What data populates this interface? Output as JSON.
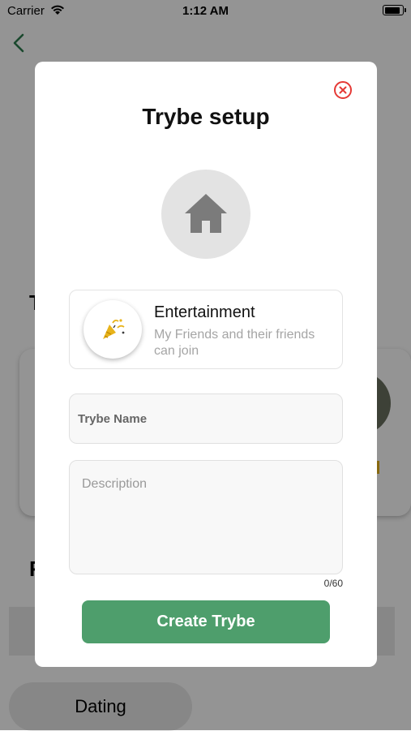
{
  "status_bar": {
    "carrier": "Carrier",
    "time": "1:12 AM"
  },
  "background": {
    "section_letters": [
      "T",
      "F"
    ],
    "pills": [
      "Dating"
    ]
  },
  "modal": {
    "title": "Trybe setup",
    "category": {
      "title": "Entertainment",
      "description": "My Friends and their friends can join",
      "icon": "party-popper-icon"
    },
    "name_field": {
      "label": "Trybe Name"
    },
    "description_field": {
      "placeholder": "Description",
      "count": "0/60"
    },
    "create_button": "Create Trybe"
  },
  "colors": {
    "accent_green": "#4e9e6c",
    "close_red": "#e53935",
    "back_green": "#2e7d4f"
  }
}
